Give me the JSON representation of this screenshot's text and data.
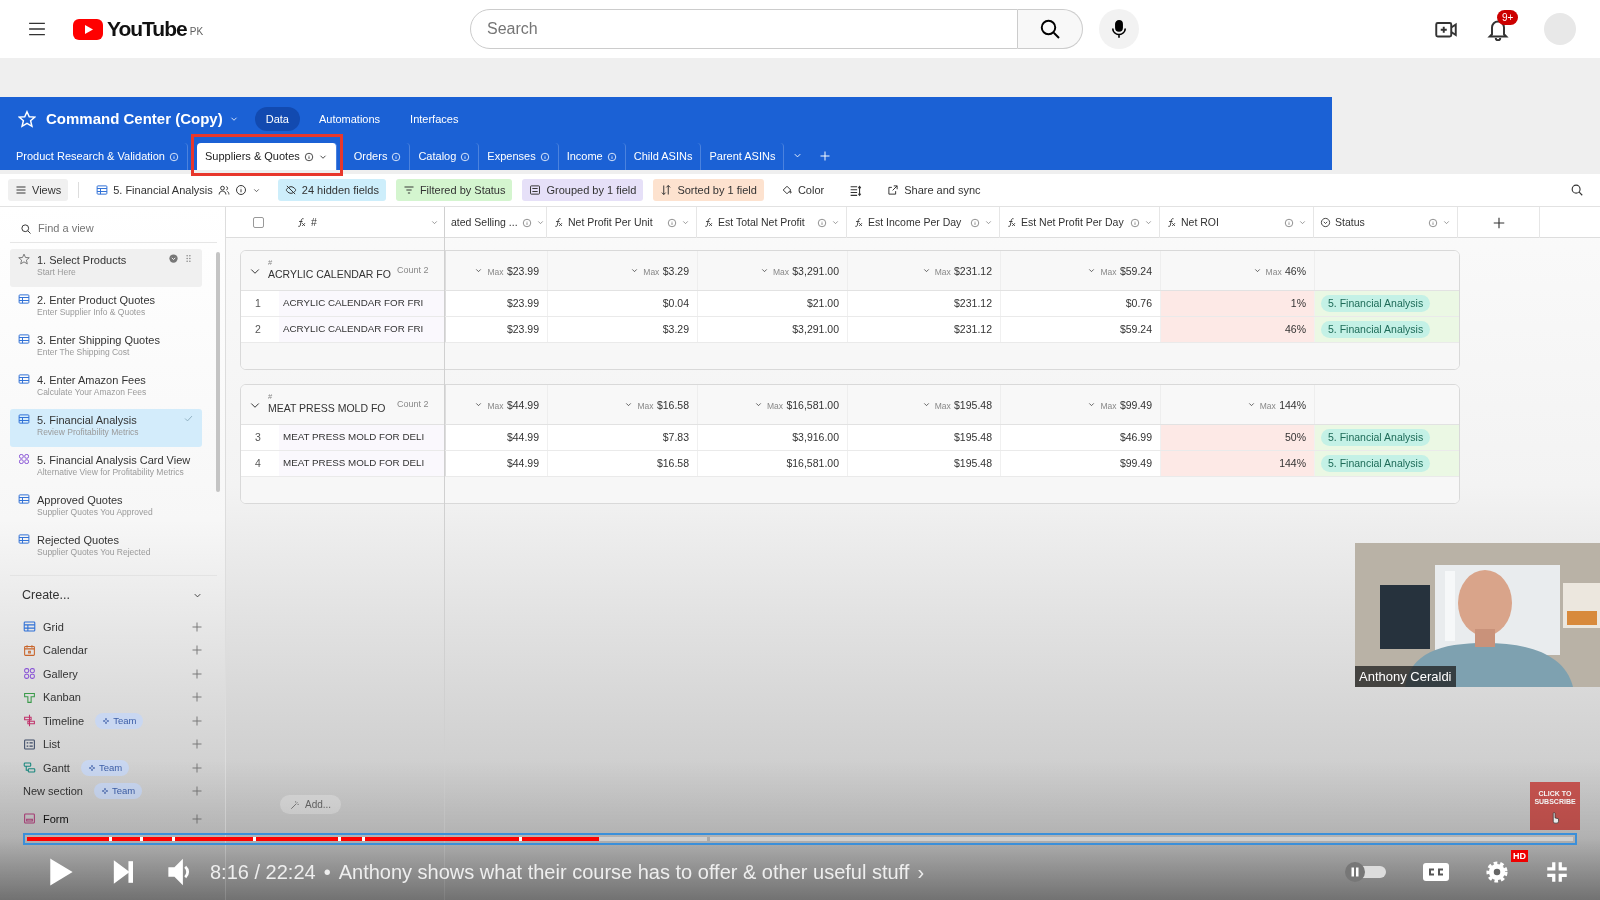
{
  "youtube": {
    "logo": "YouTube",
    "country": "PK",
    "search": {
      "placeholder": "Search"
    },
    "notifications": "9+"
  },
  "app": {
    "title": "Command Center (Copy)",
    "top_tabs": [
      {
        "label": "Data",
        "selected": true
      },
      {
        "label": "Automations",
        "selected": false
      },
      {
        "label": "Interfaces",
        "selected": false
      }
    ],
    "tables": [
      {
        "label": "Product Research & Validation",
        "info": true,
        "selected": false
      },
      {
        "label": "Suppliers & Quotes",
        "info": true,
        "selected": true
      },
      {
        "label": "Orders",
        "info": true,
        "selected": false
      },
      {
        "label": "Catalog",
        "info": true,
        "selected": false
      },
      {
        "label": "Expenses",
        "info": true,
        "selected": false
      },
      {
        "label": "Income",
        "info": true,
        "selected": false
      },
      {
        "label": "Child ASINs",
        "info": false,
        "selected": false
      },
      {
        "label": "Parent ASINs",
        "info": false,
        "selected": false
      }
    ],
    "toolbar": {
      "views": "Views",
      "view_name": "5. Financial Analysis",
      "chips": [
        {
          "label": "24 hidden fields",
          "kind": "hide",
          "color": "#cdeefb"
        },
        {
          "label": "Filtered by Status",
          "kind": "filter",
          "color": "#d4f5cf"
        },
        {
          "label": "Grouped by 1 field",
          "kind": "group",
          "color": "#e6e0f8"
        },
        {
          "label": "Sorted by 1 field",
          "kind": "sort",
          "color": "#fde2cf"
        }
      ],
      "color_button": "Color",
      "share": "Share and sync"
    },
    "sidebar": {
      "search": {
        "placeholder": "Find a view"
      },
      "views": [
        {
          "kind": "star",
          "name": "1. Select Products",
          "description": "Start Here",
          "selected": false,
          "hovered": true
        },
        {
          "kind": "grid",
          "name": "2. Enter Product Quotes",
          "description": "Enter Supplier Info & Quotes",
          "selected": false,
          "hovered": false
        },
        {
          "kind": "grid",
          "name": "3. Enter Shipping Quotes",
          "description": "Enter The Shipping Cost",
          "selected": false,
          "hovered": false
        },
        {
          "kind": "grid",
          "name": "4. Enter Amazon Fees",
          "description": "Calculate Your Amazon Fees",
          "selected": false,
          "hovered": false
        },
        {
          "kind": "grid",
          "name": "5. Financial Analysis",
          "description": "Review Profitability Metrics",
          "selected": true,
          "hovered": false
        },
        {
          "kind": "gallery",
          "name": "5. Financial Analysis Card View",
          "description": "Alternative View for Profitability Metrics",
          "selected": false,
          "hovered": false
        },
        {
          "kind": "grid",
          "name": "Approved Quotes",
          "description": "Supplier Quotes You Approved",
          "selected": false,
          "hovered": false
        },
        {
          "kind": "grid",
          "name": "Rejected Quotes",
          "description": "Supplier Quotes You Rejected",
          "selected": false,
          "hovered": false
        }
      ],
      "create": {
        "label": "Create...",
        "items": [
          {
            "label": "Grid",
            "kind": "grid",
            "team": false
          },
          {
            "label": "Calendar",
            "kind": "calendar",
            "team": false
          },
          {
            "label": "Gallery",
            "kind": "gallery",
            "team": false
          },
          {
            "label": "Kanban",
            "kind": "kanban",
            "team": false
          },
          {
            "label": "Timeline",
            "kind": "timeline",
            "team": true,
            "badge": "Team"
          },
          {
            "label": "List",
            "kind": "list",
            "team": false
          },
          {
            "label": "Gantt",
            "kind": "gantt",
            "team": true,
            "badge": "Team"
          },
          {
            "label": "New section",
            "kind": "section",
            "team": true,
            "badge": "Team"
          },
          {
            "label": "Form",
            "kind": "form",
            "team": false
          }
        ]
      }
    },
    "grid": {
      "select_all": {
        "checked": false
      },
      "columns": [
        {
          "label": "#",
          "kind": "formula",
          "info": false
        },
        {
          "label": "ated Selling ...",
          "kind": "text",
          "info": true
        },
        {
          "label": "Net Profit Per Unit",
          "kind": "formula",
          "info": true
        },
        {
          "label": "Est Total Net Profit",
          "kind": "formula",
          "info": true
        },
        {
          "label": "Est Income Per Day",
          "kind": "formula",
          "info": true
        },
        {
          "label": "Est Net Profit Per Day",
          "kind": "formula",
          "info": true
        },
        {
          "label": "Net ROI",
          "kind": "formula",
          "info": true,
          "color": "#fde9e6"
        },
        {
          "label": "Status",
          "kind": "status",
          "info": true,
          "color": "#ebf8e4"
        }
      ],
      "groups": [
        {
          "field_label": "#",
          "title": "ACRYLIC CALENDAR FO",
          "count": "Count 2",
          "summaries": [
            {
              "label": "Max",
              "value": "$23.99"
            },
            {
              "label": "Max",
              "value": "$3.29"
            },
            {
              "label": "Max",
              "value": "$3,291.00"
            },
            {
              "label": "Max",
              "value": "$231.12"
            },
            {
              "label": "Max",
              "value": "$59.24"
            },
            {
              "label": "Max",
              "value": "46%"
            }
          ],
          "rows": [
            {
              "number": "1",
              "name": "ACRYLIC CALENDAR FOR FRI",
              "values": [
                "$23.99",
                "$0.04",
                "$21.00",
                "$231.12",
                "$0.76",
                "1%"
              ],
              "status": {
                "label": "5. Financial Analysis",
                "color": "#c4f1e6"
              }
            },
            {
              "number": "2",
              "name": "ACRYLIC CALENDAR FOR FRI",
              "values": [
                "$23.99",
                "$3.29",
                "$3,291.00",
                "$231.12",
                "$59.24",
                "46%"
              ],
              "status": {
                "label": "5. Financial Analysis",
                "color": "#c4f1e6"
              }
            }
          ]
        },
        {
          "field_label": "#",
          "title": "MEAT PRESS MOLD FO",
          "count": "Count 2",
          "summaries": [
            {
              "label": "Max",
              "value": "$44.99"
            },
            {
              "label": "Max",
              "value": "$16.58"
            },
            {
              "label": "Max",
              "value": "$16,581.00"
            },
            {
              "label": "Max",
              "value": "$195.48"
            },
            {
              "label": "Max",
              "value": "$99.49"
            },
            {
              "label": "Max",
              "value": "144%"
            }
          ],
          "rows": [
            {
              "number": "3",
              "name": "MEAT PRESS MOLD FOR DELI",
              "values": [
                "$44.99",
                "$7.83",
                "$3,916.00",
                "$195.48",
                "$46.99",
                "50%"
              ],
              "status": {
                "label": "5. Financial Analysis",
                "color": "#c4f1e6"
              }
            },
            {
              "number": "4",
              "name": "MEAT PRESS MOLD FOR DELI",
              "values": [
                "$44.99",
                "$16.58",
                "$16,581.00",
                "$195.48",
                "$99.49",
                "144%"
              ],
              "status": {
                "label": "5. Financial Analysis",
                "color": "#c4f1e6"
              }
            }
          ]
        }
      ],
      "add": "Add..."
    }
  },
  "video": {
    "webcam": {
      "kind": "picture",
      "caption": "Anthony Ceraldi"
    },
    "subscribe": "CLICK TO SUBSCRIBE",
    "progress": {
      "level": 0.37
    },
    "time": "8:16 / 22:24",
    "separator": "•",
    "chapter": "Anthony shows what their course has to offer & other useful stuff",
    "chapter_arrow": "›",
    "autoplay": {
      "on": false
    },
    "hd": "HD"
  }
}
